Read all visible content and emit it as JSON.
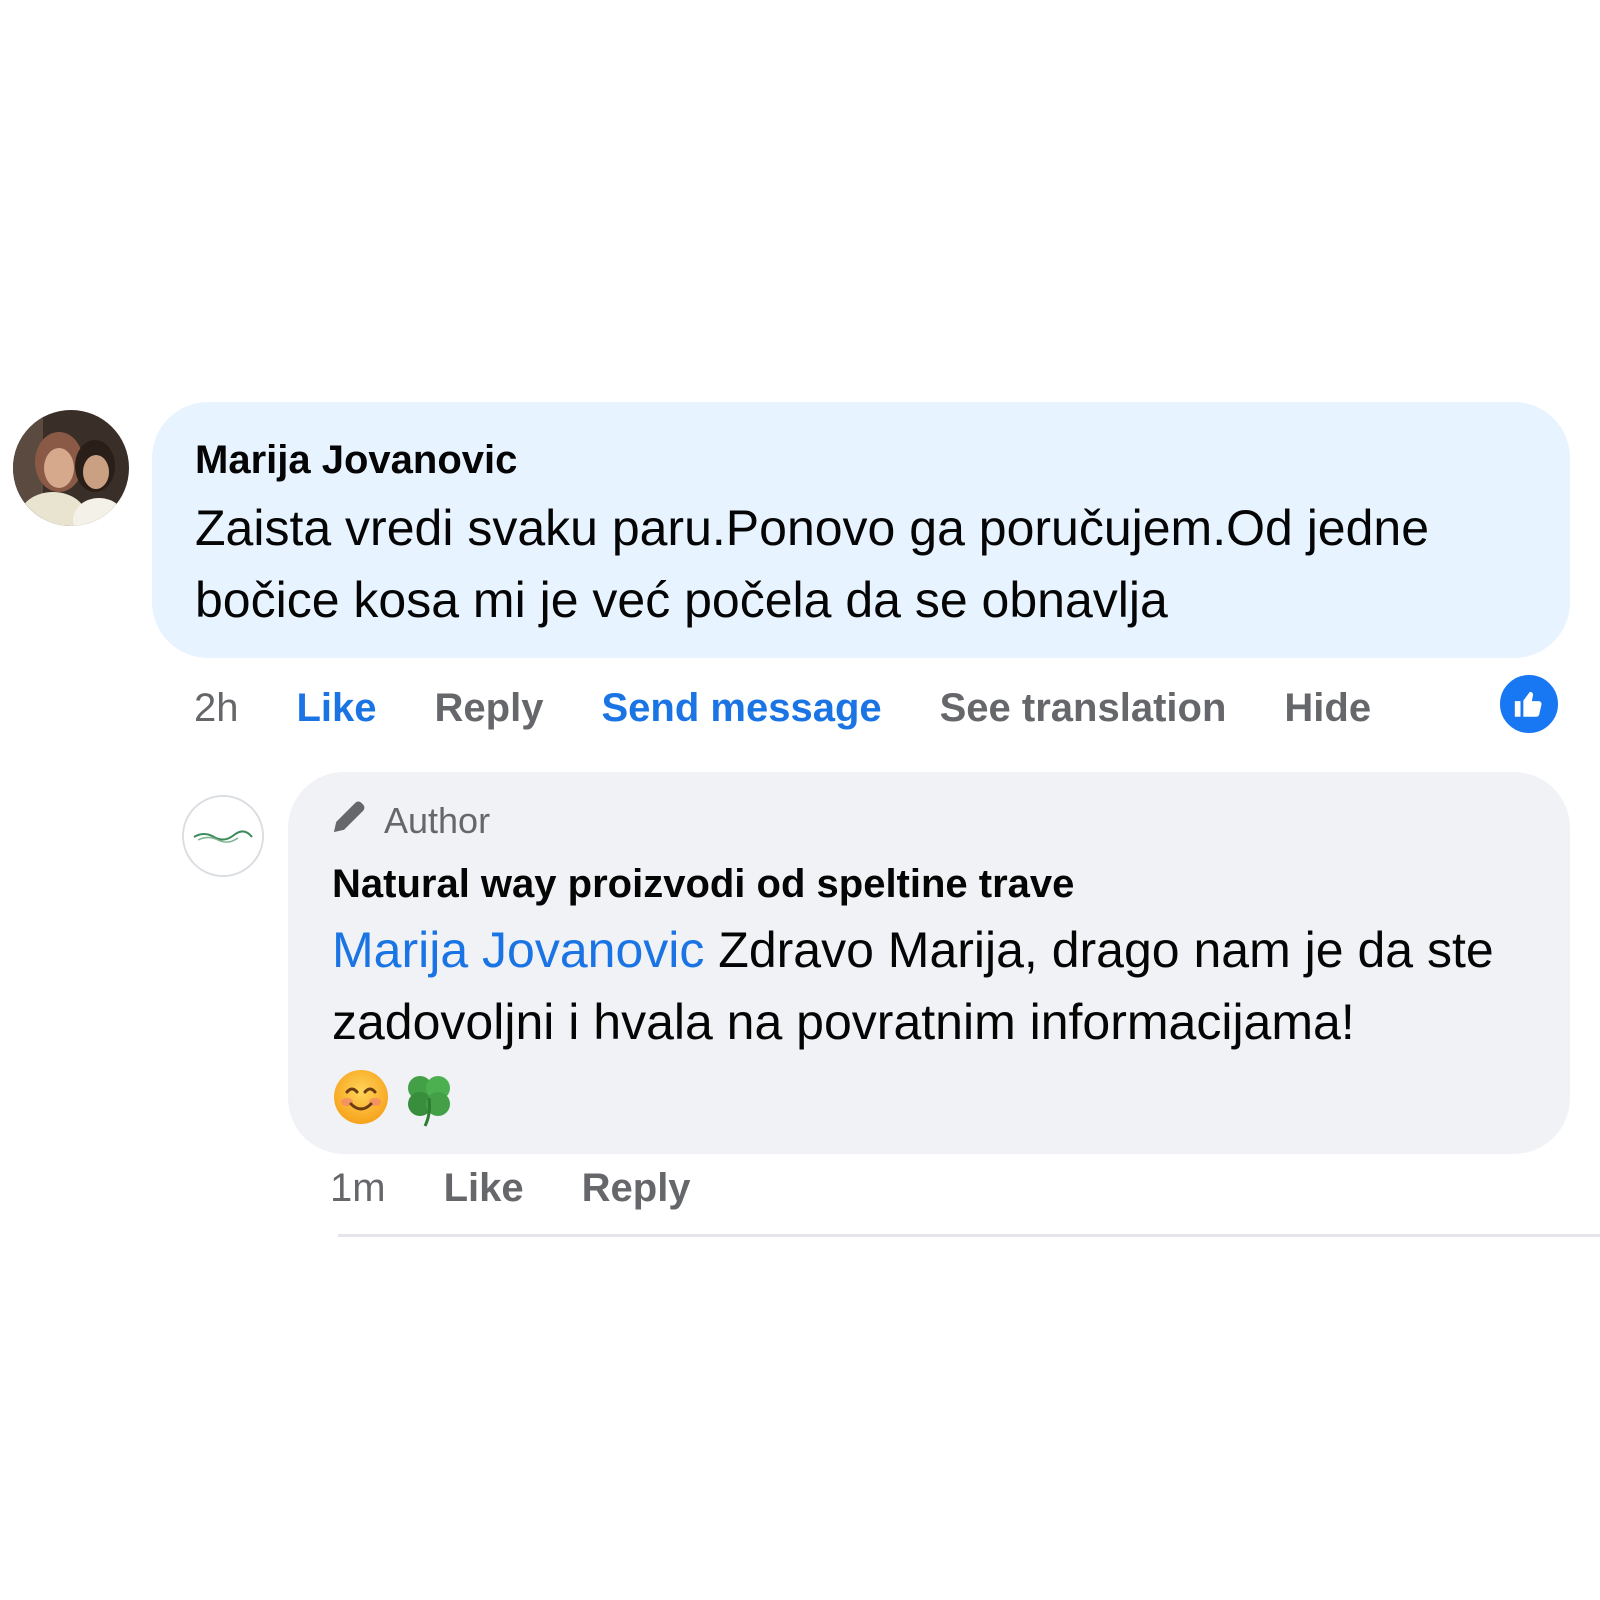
{
  "comment": {
    "author": "Marija Jovanovic",
    "text": "Zaista vredi svaku paru.Ponovo ga poručujem.Od jedne bočice kosa mi je već počela da se obnavlja",
    "timestamp": "2h",
    "actions": {
      "like": "Like",
      "reply": "Reply",
      "send_message": "Send message",
      "see_translation": "See translation",
      "hide": "Hide"
    },
    "reaction_icon": "thumbs-up-icon",
    "colors": {
      "bubble": "#e7f3ff",
      "link_blue": "#1b74e4",
      "muted": "#65676b",
      "reaction_badge": "#1877f2"
    }
  },
  "reply": {
    "badge": "Author",
    "badge_icon": "pencil-icon",
    "author": "Natural way proizvodi od speltine trave",
    "mention": "Marija Jovanovic",
    "text": "Zdravo Marija, drago nam je da ste zadovoljni i hvala na povratnim informacijama!",
    "emojis": [
      "smiling-face-icon",
      "four-leaf-clover-icon"
    ],
    "timestamp": "1m",
    "actions": {
      "like": "Like",
      "reply": "Reply"
    },
    "colors": {
      "bubble": "#f0f2f5"
    }
  }
}
